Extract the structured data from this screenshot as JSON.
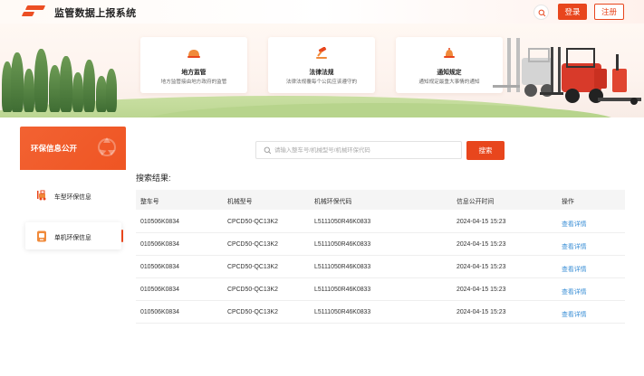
{
  "header": {
    "title": "监管数据上报系统",
    "login_label": "登录",
    "register_label": "注册"
  },
  "features": [
    {
      "title": "地方监管",
      "desc": "地方监管接由地方政府的监管",
      "icon": "helmet-icon"
    },
    {
      "title": "法律法规",
      "desc": "法律法规覆每个公民应该遵守的",
      "icon": "gavel-icon"
    },
    {
      "title": "通知规定",
      "desc": "通知规定最重大事情的通知",
      "icon": "bell-icon"
    }
  ],
  "sidebar": {
    "header": "环保信息公开",
    "items": [
      {
        "label": "车型环保信息",
        "icon": "forklift-icon"
      },
      {
        "label": "单机环保信息",
        "icon": "device-icon"
      }
    ]
  },
  "search": {
    "placeholder": "请输入整车号/机械型号/机械环保代码",
    "value": "",
    "button_label": "搜索"
  },
  "results": {
    "title": "搜索结果:",
    "columns": [
      "整车号",
      "机械型号",
      "机械环保代码",
      "信息公开时间",
      "操作"
    ],
    "rows": [
      [
        "010506K0834",
        "CPCD50-QC13K2",
        "L5111050R46K0833",
        "2024-04-15  15:23",
        "查看详情"
      ],
      [
        "010506K0834",
        "CPCD50-QC13K2",
        "L5111050R46K0833",
        "2024-04-15  15:23",
        "查看详情"
      ],
      [
        "010506K0834",
        "CPCD50-QC13K2",
        "L5111050R46K0833",
        "2024-04-15  15:23",
        "查看详情"
      ],
      [
        "010506K0834",
        "CPCD50-QC13K2",
        "L5111050R46K0833",
        "2024-04-15  15:23",
        "查看详情"
      ],
      [
        "010506K0834",
        "CPCD50-QC13K2",
        "L5111050R46K0833",
        "2024-04-15  15:23",
        "查看详情"
      ]
    ]
  },
  "colors": {
    "accent": "#e8461d",
    "link": "#3b8fd6"
  }
}
